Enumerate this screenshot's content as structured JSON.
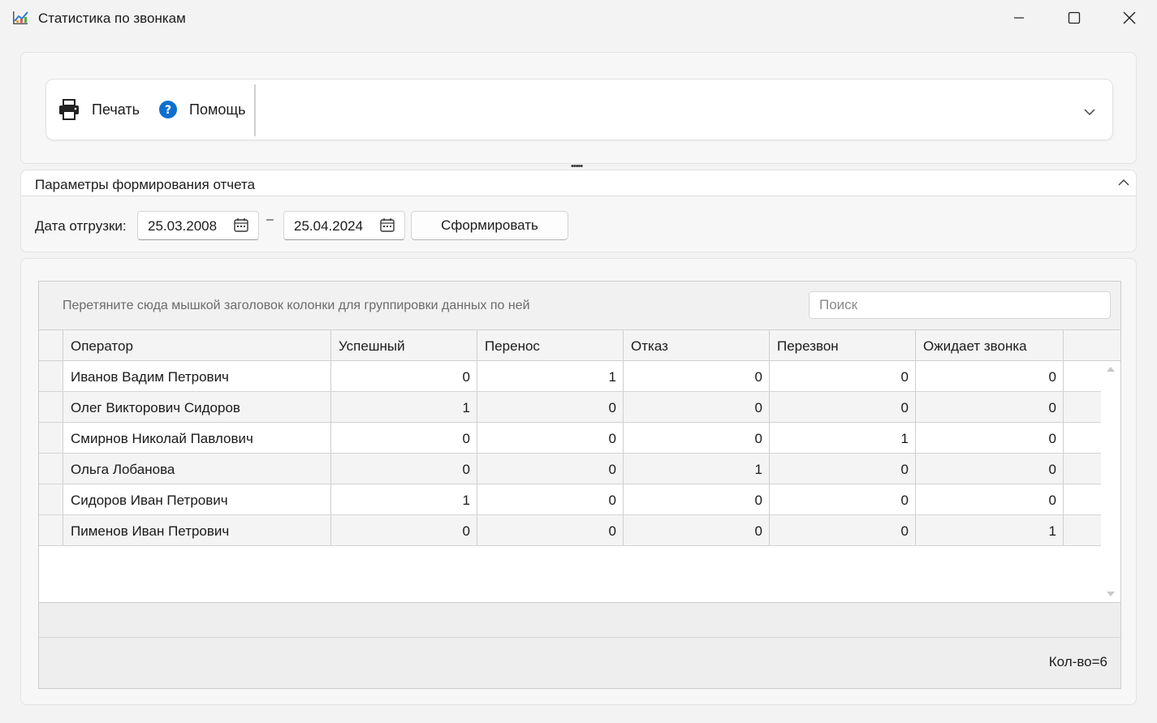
{
  "window": {
    "title": "Статистика по звонкам"
  },
  "toolbar": {
    "print_label": "Печать",
    "help_label": "Помощь"
  },
  "params": {
    "title": "Параметры формирования отчета",
    "date_label": "Дата отгрузки:",
    "date_from": "25.03.2008",
    "date_dash": "–",
    "date_to": "25.04.2024",
    "form_button": "Сформировать"
  },
  "grid": {
    "group_hint": "Перетяните сюда мышкой заголовок колонки для группировки данных по ней",
    "search_placeholder": "Поиск",
    "columns": [
      "Оператор",
      "Успешный",
      "Перенос",
      "Отказ",
      "Перезвон",
      "Ожидает звонка"
    ],
    "rows": [
      [
        "Иванов Вадим Петрович",
        "0",
        "1",
        "0",
        "0",
        "0"
      ],
      [
        "Олег Викторович Сидоров",
        "1",
        "0",
        "0",
        "0",
        "0"
      ],
      [
        "Смирнов Николай Павлович",
        "0",
        "0",
        "0",
        "1",
        "0"
      ],
      [
        "Ольга Лобанова",
        "0",
        "0",
        "1",
        "0",
        "0"
      ],
      [
        "Сидоров Иван Петрович",
        "1",
        "0",
        "0",
        "0",
        "0"
      ],
      [
        "Пименов Иван Петрович",
        "0",
        "0",
        "0",
        "0",
        "1"
      ]
    ],
    "count_text": "Кол-во=6"
  },
  "colors": {
    "help_icon": "#0e6fcf",
    "accent": "#0e6fcf"
  }
}
